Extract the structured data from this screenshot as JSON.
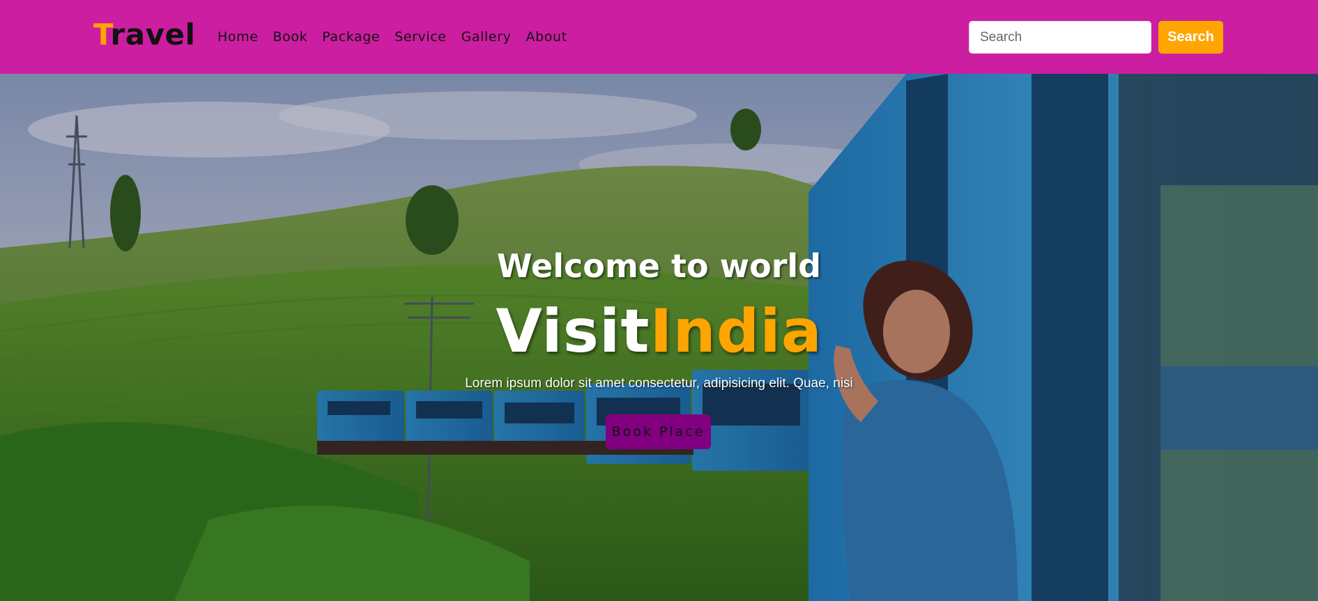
{
  "navbar": {
    "brand_first": "T",
    "brand_rest": "ravel",
    "links": [
      "Home",
      "Book",
      "Package",
      "Service",
      "Gallery",
      "About"
    ],
    "search_placeholder": "Search",
    "search_button": "Search"
  },
  "hero": {
    "welcome": "Welcome to world",
    "title_main": "Visit",
    "title_accent": "India",
    "subtitle": "Lorem ipsum dolor sit amet consectetur, adipisicing elit. Quae, nisi",
    "button": "Book Place",
    "image_alt": "Woman leaning out of a blue train window in green tea hills"
  },
  "colors": {
    "navbar_bg": "#cc1ea0",
    "accent": "#ffa500",
    "button_bg": "#800080"
  }
}
